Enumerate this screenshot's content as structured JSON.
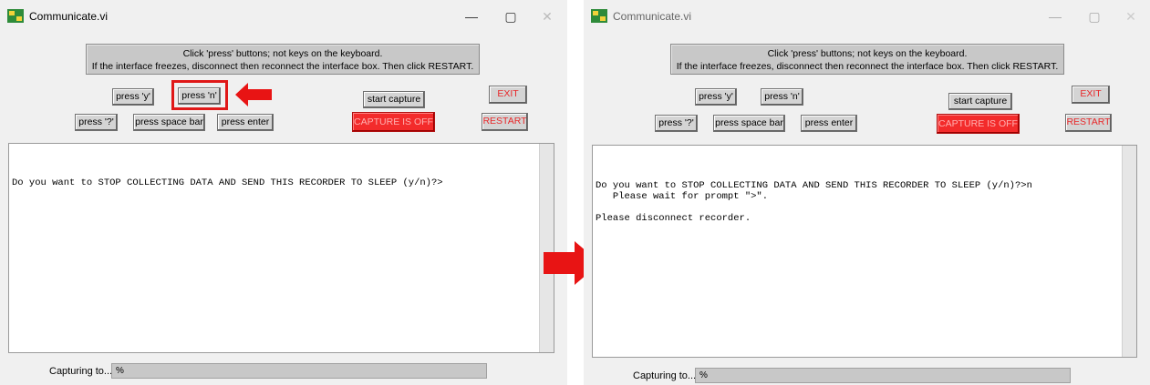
{
  "window": {
    "title": "Communicate.vi",
    "minimize_glyph": "—",
    "maximize_glyph": "▢",
    "close_glyph": "✕"
  },
  "notice": {
    "line1": "Click 'press' buttons; not keys on the keyboard.",
    "line2": "If the interface freezes, disconnect then reconnect the interface box. Then click RESTART."
  },
  "buttons": {
    "press_y": "press 'y'",
    "press_n": "press 'n'",
    "press_q": "press '?'",
    "press_space": "press space bar",
    "press_enter": "press enter",
    "start_capture": "start capture",
    "capture_status": "CAPTURE IS OFF",
    "exit": "EXIT",
    "restart": "RESTART"
  },
  "console_before": {
    "line1": "Do you want to STOP COLLECTING DATA AND SEND THIS RECORDER TO SLEEP (y/n)?>"
  },
  "console_after": {
    "line1": "Do you want to STOP COLLECTING DATA AND SEND THIS RECORDER TO SLEEP (y/n)?>n",
    "line2": "   Please wait for prompt \">\".",
    "line3": "Please disconnect recorder."
  },
  "capture": {
    "label": "Capturing to...",
    "value": "%"
  },
  "colors": {
    "highlight": "#e01818",
    "capture_off": "#f32b2b",
    "arrow": "#e81414"
  }
}
